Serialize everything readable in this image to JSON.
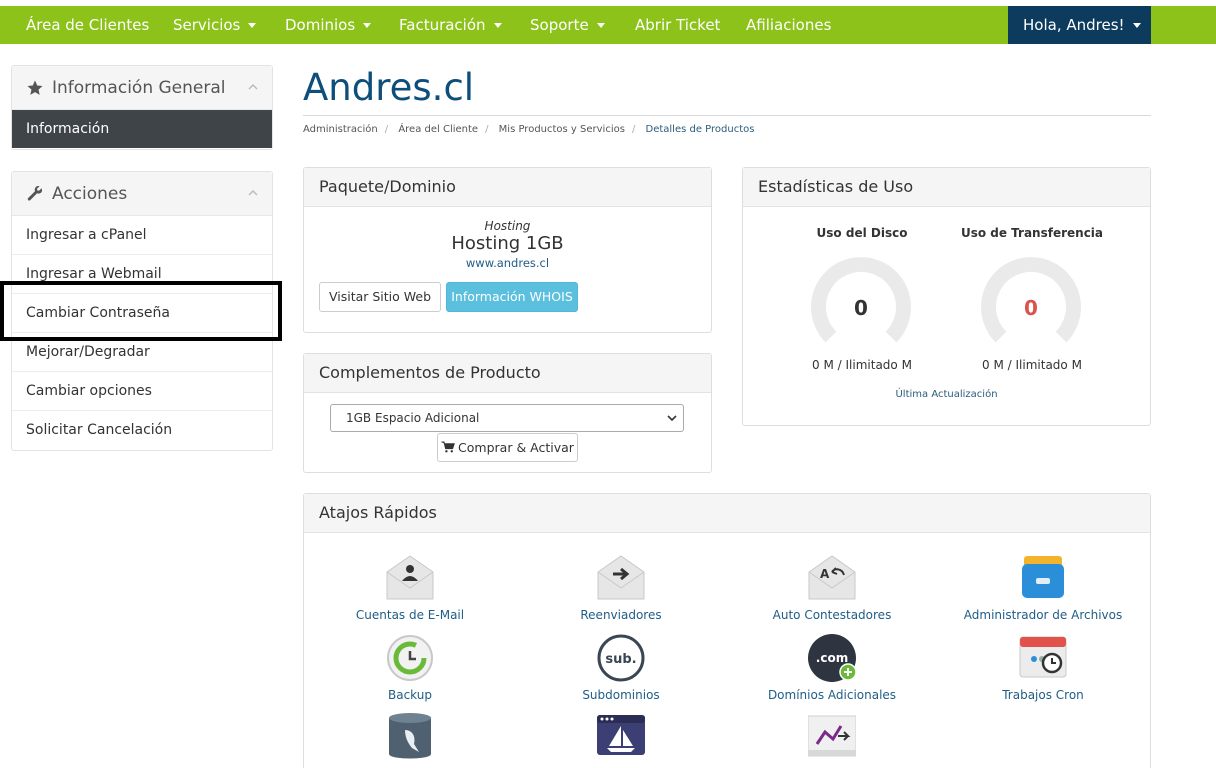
{
  "nav": {
    "items": [
      {
        "label": "Área de Clientes",
        "dropdown": false
      },
      {
        "label": "Servicios",
        "dropdown": true
      },
      {
        "label": "Dominios",
        "dropdown": true
      },
      {
        "label": "Facturación",
        "dropdown": true
      },
      {
        "label": "Soporte",
        "dropdown": true
      },
      {
        "label": "Abrir Ticket",
        "dropdown": false
      },
      {
        "label": "Afiliaciones",
        "dropdown": false
      }
    ],
    "user_label": "Hola, Andres!"
  },
  "sidebar": {
    "info": {
      "title": "Información General",
      "active_item": "Información"
    },
    "actions": {
      "title": "Acciones",
      "items": [
        "Ingresar a cPanel",
        "Ingresar a Webmail",
        "Cambiar Contraseña",
        "Mejorar/Degradar",
        "Cambiar opciones",
        "Solicitar Cancelación"
      ]
    }
  },
  "page": {
    "title": "Andres.cl",
    "breadcrumb": [
      "Administración",
      "Área del Cliente",
      "Mis Productos y Servicios",
      "Detalles de Productos"
    ]
  },
  "package": {
    "title": "Paquete/Dominio",
    "type": "Hosting",
    "name": "Hosting 1GB",
    "domain": "www.andres.cl",
    "visit_button": "Visitar Sitio Web",
    "whois_button": "Información WHOIS"
  },
  "addons": {
    "title": "Complementos de Producto",
    "selected": "1GB Espacio Adicional",
    "buy_button": "Comprar & Activar"
  },
  "stats": {
    "title": "Estadísticas de Uso",
    "disk": {
      "label": "Uso del Disco",
      "value": "0",
      "usage": "0 M / Ilimitado M",
      "color": "#333333"
    },
    "transfer": {
      "label": "Uso de Transferencia",
      "value": "0",
      "usage": "0 M / Ilimitado M",
      "color": "#d9534f"
    },
    "update_link": "Última Actualización"
  },
  "shortcuts": {
    "title": "Atajos Rápidos",
    "items": [
      {
        "label": "Cuentas de E-Mail",
        "icon": "email-accounts-icon"
      },
      {
        "label": "Reenviadores",
        "icon": "forwarders-icon"
      },
      {
        "label": "Auto Contestadores",
        "icon": "autoresponders-icon"
      },
      {
        "label": "Administrador de Archivos",
        "icon": "file-manager-icon"
      },
      {
        "label": "Backup",
        "icon": "backup-icon"
      },
      {
        "label": "Subdominios",
        "icon": "subdomains-icon"
      },
      {
        "label": "Domínios Adicionales",
        "icon": "addon-domains-icon"
      },
      {
        "label": "Trabajos Cron",
        "icon": "cron-jobs-icon"
      },
      {
        "label": "",
        "icon": "mysql-icon"
      },
      {
        "label": "",
        "icon": "site-builder-icon"
      },
      {
        "label": "",
        "icon": "stats-icon"
      }
    ]
  },
  "colors": {
    "nav_green": "#8cc21a",
    "nav_user": "#0d3b5e",
    "title_blue": "#0d4f7a",
    "info_button": "#5bc0de"
  }
}
